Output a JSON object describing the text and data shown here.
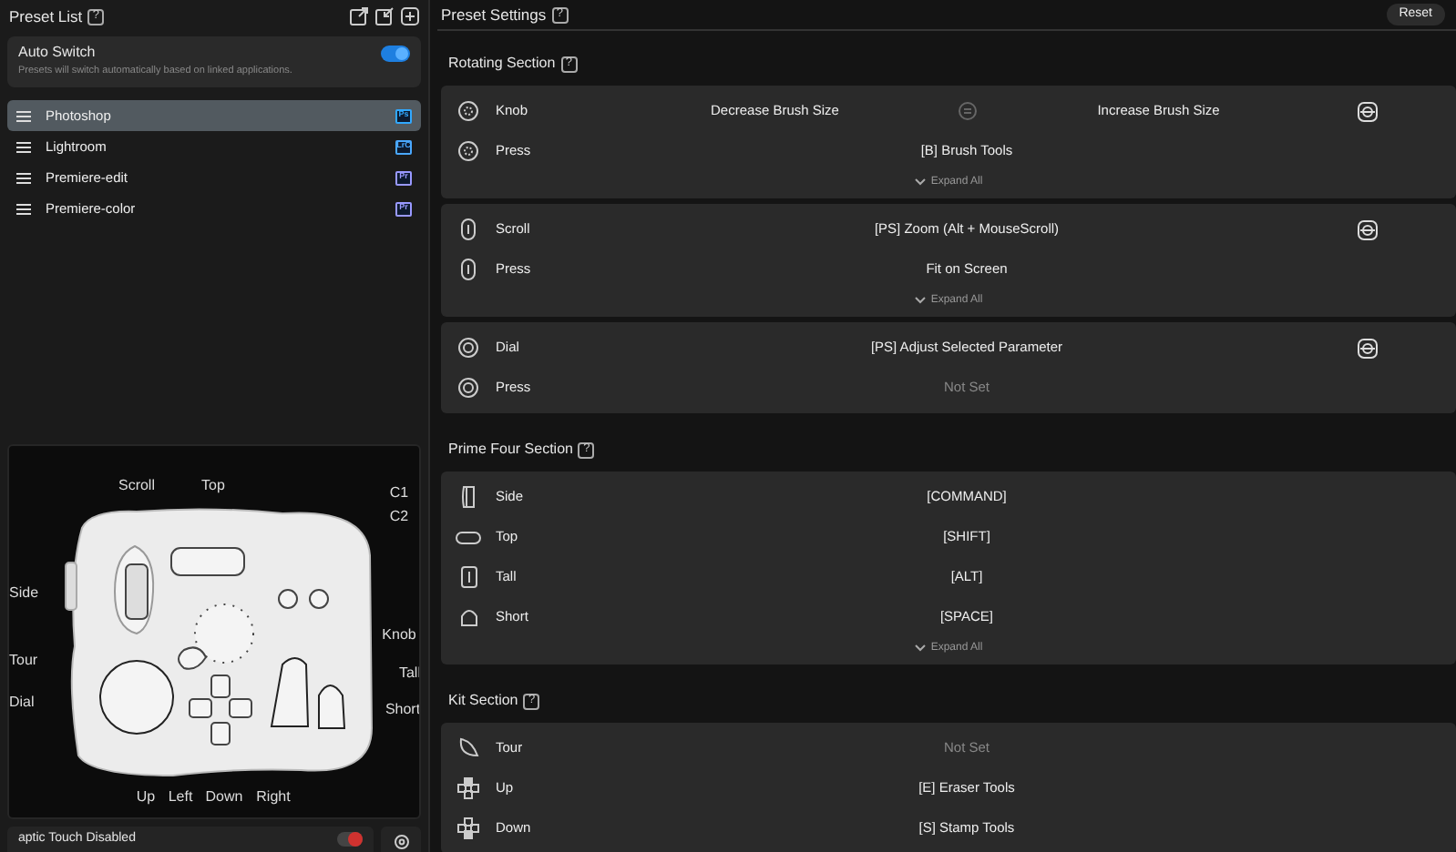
{
  "preset_list": {
    "title": "Preset List",
    "help": "?",
    "auto_switch": {
      "title": "Auto Switch",
      "description": "Presets will switch automatically based on linked applications.",
      "on": true
    },
    "items": [
      {
        "label": "Photoshop",
        "app": "Ps",
        "color": "#31a8ff",
        "selected": true
      },
      {
        "label": "Lightroom",
        "app": "LrC",
        "color": "#4aa8ff",
        "selected": false
      },
      {
        "label": "Premiere-edit",
        "app": "Pr",
        "color": "#9999ff",
        "selected": false
      },
      {
        "label": "Premiere-color",
        "app": "Pr",
        "color": "#9999ff",
        "selected": false
      }
    ]
  },
  "device": {
    "labels": [
      "Scroll",
      "Top",
      "C1",
      "C2",
      "Side",
      "Knob",
      "Tour",
      "Tall",
      "Dial",
      "Short",
      "Up",
      "Left",
      "Down",
      "Right"
    ]
  },
  "bottom_bar": {
    "label": "aptic Touch Disabled",
    "on": true
  },
  "preset_settings": {
    "title": "Preset Settings",
    "help": "?",
    "reset": "Reset",
    "sections": [
      {
        "title": "Rotating Section",
        "help": "?",
        "cards": [
          {
            "expand": "Expand All",
            "rows": [
              {
                "kind": "knob",
                "label": "Knob",
                "value_left": "Decrease Brush Size",
                "value_right": "Increase Brush Size",
                "unset": false,
                "adjustable": true
              },
              {
                "kind": "knob",
                "label": "Press",
                "value": "[B] Brush Tools",
                "unset": false,
                "adjustable": false
              }
            ]
          },
          {
            "expand": "Expand All",
            "rows": [
              {
                "kind": "scroll",
                "label": "Scroll",
                "value": "[PS] Zoom (Alt + MouseScroll)",
                "unset": false,
                "adjustable": true
              },
              {
                "kind": "scroll",
                "label": "Press",
                "value": "Fit on Screen",
                "unset": false,
                "adjustable": false
              }
            ]
          },
          {
            "rows": [
              {
                "kind": "dial",
                "label": "Dial",
                "value": "[PS] Adjust Selected Parameter",
                "unset": false,
                "adjustable": true
              },
              {
                "kind": "dial",
                "label": "Press",
                "value": "Not Set",
                "unset": true,
                "adjustable": false
              }
            ]
          }
        ]
      },
      {
        "title": "Prime Four Section",
        "help": "?",
        "cards": [
          {
            "expand": "Expand All",
            "rows": [
              {
                "kind": "side",
                "label": "Side",
                "value": "[COMMAND]",
                "unset": false,
                "adjustable": false
              },
              {
                "kind": "top",
                "label": "Top",
                "value": "[SHIFT]",
                "unset": false,
                "adjustable": false
              },
              {
                "kind": "tall",
                "label": "Tall",
                "value": "[ALT]",
                "unset": false,
                "adjustable": false
              },
              {
                "kind": "short",
                "label": "Short",
                "value": "[SPACE]",
                "unset": false,
                "adjustable": false
              }
            ]
          }
        ]
      },
      {
        "title": "Kit Section",
        "help": "?",
        "cards": [
          {
            "rows": [
              {
                "kind": "tour",
                "label": "Tour",
                "value": "Not Set",
                "unset": true,
                "adjustable": false
              },
              {
                "kind": "dpad-up",
                "label": "Up",
                "value": "[E] Eraser Tools",
                "unset": false,
                "adjustable": false
              },
              {
                "kind": "dpad-down",
                "label": "Down",
                "value": "[S] Stamp Tools",
                "unset": false,
                "adjustable": false
              }
            ]
          }
        ]
      }
    ]
  }
}
